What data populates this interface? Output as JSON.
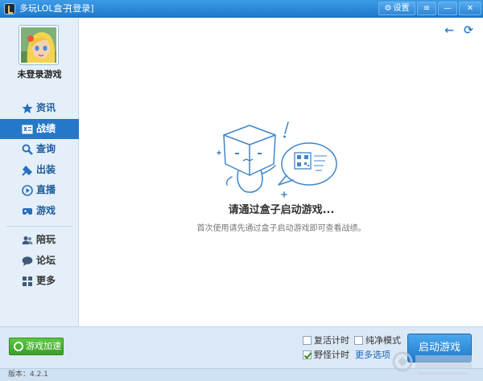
{
  "titlebar": {
    "app_title": "多玩LOL盒子",
    "login_link": "[登录]",
    "settings_label": "设置",
    "menu_glyph": "≡",
    "minimize_glyph": "—",
    "close_glyph": "✕"
  },
  "sidebar": {
    "username": "未登录游戏",
    "items": [
      {
        "label": "资讯",
        "icon": "star-icon"
      },
      {
        "label": "战绩",
        "icon": "scorecard-icon",
        "active": true
      },
      {
        "label": "查询",
        "icon": "search-icon"
      },
      {
        "label": "出装",
        "icon": "equipment-icon"
      },
      {
        "label": "直播",
        "icon": "play-icon"
      },
      {
        "label": "游戏",
        "icon": "gamepad-icon"
      }
    ],
    "extra_items": [
      {
        "label": "陪玩",
        "icon": "people-icon"
      },
      {
        "label": "论坛",
        "icon": "chat-bubble-icon"
      },
      {
        "label": "更多",
        "icon": "grid-icon"
      }
    ]
  },
  "main": {
    "back_glyph": "←",
    "refresh_glyph": "⟳",
    "message_title": "请通过盒子启动游戏...",
    "message_sub": "首次使用请先通过盒子启动游戏即可查看战绩。"
  },
  "bottom": {
    "accelerate_label": "游戏加速",
    "opt_revive": "复活计时",
    "opt_pure": "纯净模式",
    "opt_wild": "野怪计时",
    "more_options": "更多选项",
    "launch_label": "启动游戏",
    "version": "版本：4.2.1"
  },
  "colors": {
    "accent": "#2578c9",
    "sidebar_bg": "#e4eff9",
    "launch_button": "#2f8ad9",
    "accelerate_button": "#4bb535"
  }
}
